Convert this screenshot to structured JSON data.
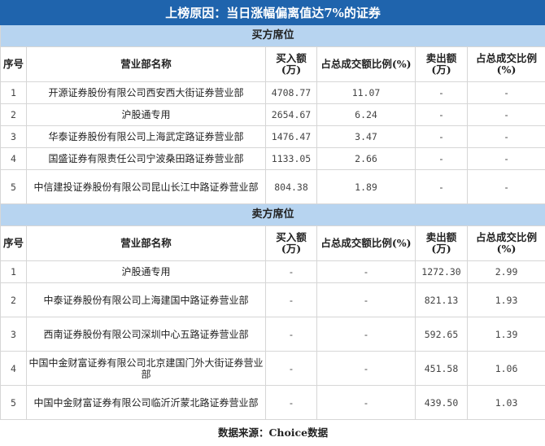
{
  "title": "上榜原因：当日涨幅偏离值达7%的证券",
  "buy": {
    "section": "买方席位",
    "headers": [
      "序号",
      "营业部名称",
      "买入额(万)",
      "占总成交额比例(%)",
      "卖出额(万)",
      "占总成交比例(%)"
    ],
    "rows": [
      [
        "1",
        "开源证券股份有限公司西安西大街证券营业部",
        "4708.77",
        "11.07",
        "-",
        "-"
      ],
      [
        "2",
        "沪股通专用",
        "2654.67",
        "6.24",
        "-",
        "-"
      ],
      [
        "3",
        "华泰证券股份有限公司上海武定路证券营业部",
        "1476.47",
        "3.47",
        "-",
        "-"
      ],
      [
        "4",
        "国盛证券有限责任公司宁波桑田路证券营业部",
        "1133.05",
        "2.66",
        "-",
        "-"
      ],
      [
        "5",
        "中信建投证券股份有限公司昆山长江中路证券营业部",
        "804.38",
        "1.89",
        "-",
        "-"
      ]
    ]
  },
  "sell": {
    "section": "卖方席位",
    "headers": [
      "序号",
      "营业部名称",
      "买入额(万)",
      "占总成交额比例(%)",
      "卖出额(万)",
      "占总成交比例(%)"
    ],
    "rows": [
      [
        "1",
        "沪股通专用",
        "-",
        "-",
        "1272.30",
        "2.99"
      ],
      [
        "2",
        "中泰证券股份有限公司上海建国中路证券营业部",
        "-",
        "-",
        "821.13",
        "1.93"
      ],
      [
        "3",
        "西南证券股份有限公司深圳中心五路证券营业部",
        "-",
        "-",
        "592.65",
        "1.39"
      ],
      [
        "4",
        "中国中金财富证券有限公司北京建国门外大街证券营业部",
        "-",
        "-",
        "451.58",
        "1.06"
      ],
      [
        "5",
        "中国中金财富证券有限公司临沂沂蒙北路证券营业部",
        "-",
        "-",
        "439.50",
        "1.03"
      ]
    ]
  },
  "footer": "数据来源：Choice数据"
}
